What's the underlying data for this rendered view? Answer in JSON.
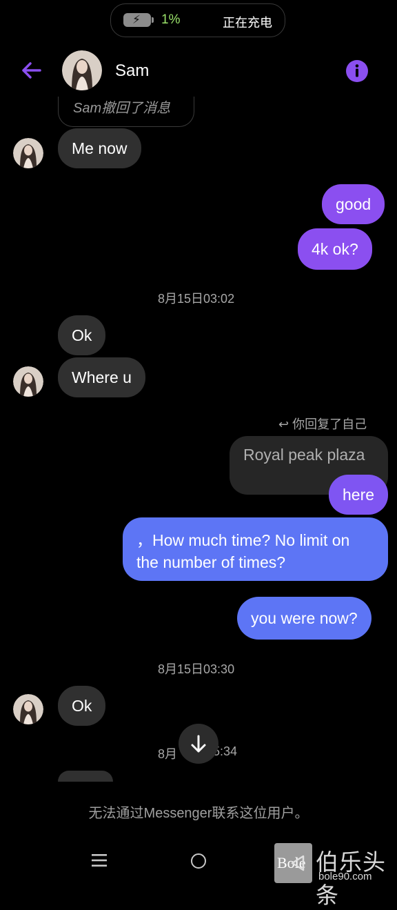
{
  "status": {
    "battery_percent": "1%",
    "charging_text": "正在充电",
    "battery_color": "#9be36b"
  },
  "header": {
    "contact_name": "Sam",
    "accent_color": "#8b4ff0"
  },
  "messages": {
    "retracted": "Sam撤回了消息",
    "me_now": "Me now",
    "good": "good",
    "fourk": "4k  ok?",
    "ts1": "8月15日03:02",
    "ok1": "Ok",
    "where_u": "Where u",
    "reply_note": "你回复了自己",
    "quoted": "Royal peak plaza",
    "here": "here",
    "how_much_line1": "，How much time? No limit on",
    "how_much_line2": "the number of times?",
    "you_were_now": "you were now?",
    "ts2": "8月15日03:30",
    "ok2": "Ok",
    "ts3_left": "8月",
    "ts3_right": "5:34"
  },
  "footer": {
    "notice": "无法通过Messenger联系这位用户。"
  },
  "watermark": {
    "brand_badge": "Bole",
    "brand_cn": "伯乐头条",
    "brand_url": "bole90.com"
  },
  "icons": {
    "back": "arrow-left-icon",
    "info": "info-icon",
    "scroll": "arrow-down-icon",
    "reply": "reply-arrow-icon"
  }
}
